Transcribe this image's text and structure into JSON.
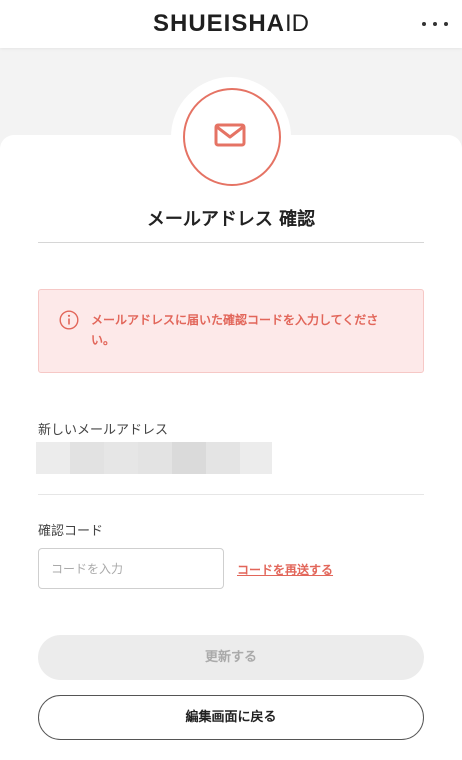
{
  "header": {
    "logo_main": "SHUEISHA",
    "logo_id": "ID",
    "menu_icon": "more-dots-icon"
  },
  "page": {
    "badge_icon": "mail-icon",
    "title": "メールアドレス 確認"
  },
  "alert": {
    "icon": "info-circle-icon",
    "message": "メールアドレスに届いた確認コードを入力してください。"
  },
  "email_section": {
    "label": "新しいメールアドレス",
    "value_masked": true
  },
  "code_section": {
    "label": "確認コード",
    "placeholder": "コードを入力",
    "value": "",
    "resend_link": "コードを再送する"
  },
  "buttons": {
    "update": "更新する",
    "back": "編集画面に戻る"
  },
  "colors": {
    "accent": "#e57364",
    "alert_bg": "#fde9e9",
    "disabled_btn": "#ececec"
  }
}
